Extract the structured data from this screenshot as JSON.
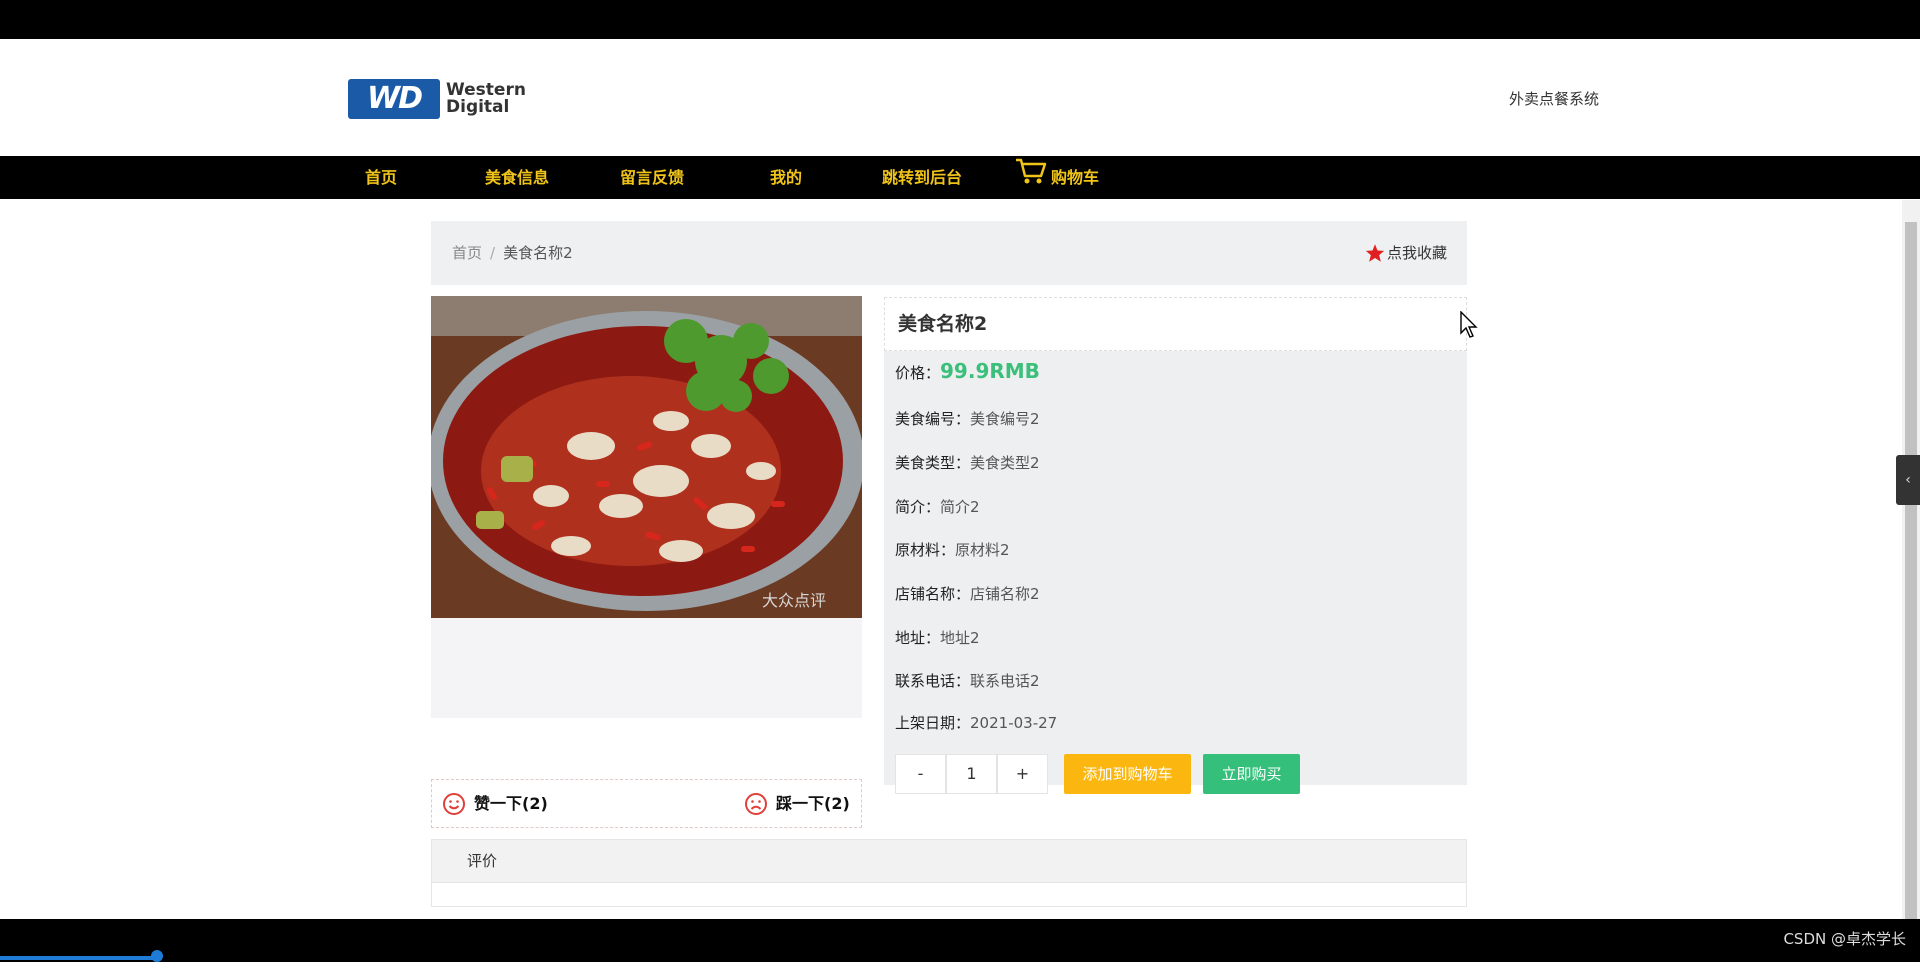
{
  "header": {
    "logo_text_line1": "Western",
    "logo_text_line2": "Digital",
    "logo_mark": "WD",
    "system_name": "外卖点餐系统"
  },
  "nav": {
    "items": [
      {
        "label": "首页"
      },
      {
        "label": "美食信息"
      },
      {
        "label": "留言反馈"
      },
      {
        "label": "我的"
      },
      {
        "label": "跳转到后台"
      },
      {
        "label": "购物车",
        "icon": "cart-icon"
      }
    ]
  },
  "breadcrumb": {
    "home": "首页",
    "separator": "/",
    "current": "美食名称2"
  },
  "favorite": {
    "label": "点我收藏",
    "icon": "star-icon",
    "color": "#e02020"
  },
  "food": {
    "name": "美食名称2",
    "price_label": "价格：",
    "price": "99.9RMB",
    "fields": [
      {
        "key": "美食编号：",
        "value": "美食编号2"
      },
      {
        "key": "美食类型：",
        "value": "美食类型2"
      },
      {
        "key": "简介：",
        "value": "简介2"
      },
      {
        "key": "原材料：",
        "value": "原材料2"
      },
      {
        "key": "店铺名称：",
        "value": "店铺名称2"
      },
      {
        "key": "地址：",
        "value": "地址2"
      },
      {
        "key": "联系电话：",
        "value": "联系电话2"
      },
      {
        "key": "上架日期：",
        "value": "2021-03-27"
      }
    ],
    "image_watermark": "大众点评"
  },
  "votes": {
    "like_label": "赞一下(2)",
    "like_icon": "smile-icon",
    "dislike_label": "踩一下(2)",
    "dislike_icon": "frown-icon"
  },
  "quantity": {
    "minus": "-",
    "value": "1",
    "plus": "+"
  },
  "actions": {
    "add_to_cart": "添加到购物车",
    "buy_now": "立即购买",
    "add_color": "#fbb710",
    "buy_color": "#34bf7a"
  },
  "review": {
    "title": "评价"
  },
  "sidebar_toggle": "‹",
  "watermark": "CSDN @卓杰学长"
}
